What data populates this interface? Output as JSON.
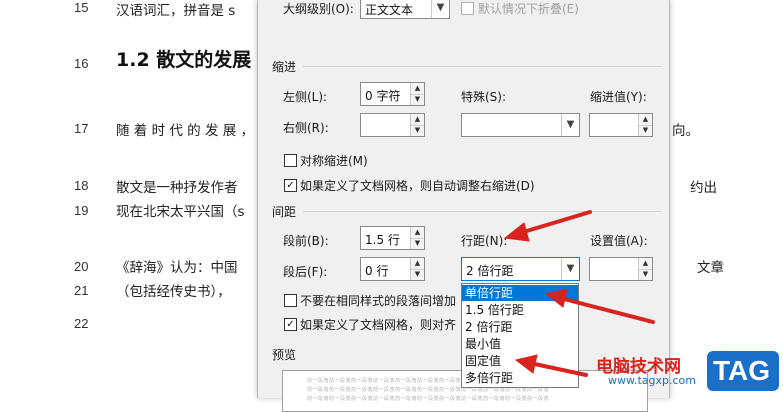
{
  "document": {
    "lines": [
      {
        "num": "15",
        "text": "汉语词汇，拼音是 s"
      },
      {
        "num": "16",
        "heading": "1.2 散文的发展"
      },
      {
        "num": "17",
        "text_left": "随 着 时 代 的 发 展 ，",
        "text_right": "向。"
      },
      {
        "num": "18",
        "text_left": "散文是一种抒发作者",
        "text_right": "约出"
      },
      {
        "num": "19",
        "text_left": "现在北宋太平兴国（s"
      },
      {
        "num": "20",
        "text_left": "《辞海》认为：中国",
        "text_right": "文章"
      },
      {
        "num": "21",
        "text_left": "（包括经传史书），"
      },
      {
        "num": "22"
      }
    ]
  },
  "dialog": {
    "outline_level_label": "大纲级别(O):",
    "outline_level_value": "正文文本",
    "collapsed_default_label": "默认情况下折叠(E)",
    "indent_section": "缩进",
    "left_label": "左侧(L):",
    "left_value": "0 字符",
    "special_label": "特殊(S):",
    "indent_value_label": "缩进值(Y):",
    "right_label": "右侧(R):",
    "mirror_indent_label": "对称缩进(M)",
    "auto_adjust_right_indent_label": "如果定义了文档网格，则自动调整右缩进(D)",
    "spacing_section": "间距",
    "before_label": "段前(B):",
    "before_value": "1.5 行",
    "line_spacing_label": "行距(N):",
    "setting_value_label": "设置值(A):",
    "after_label": "段后(F):",
    "after_value": "0 行",
    "line_spacing_value": "2 倍行距",
    "no_space_same_style_label": "不要在相同样式的段落间增加",
    "snap_to_grid_label": "如果定义了文档网格，则对齐",
    "preview_section": "预览",
    "preview_text": "前一段落前一段落前一段落前一段落前一段落前一段落前一段落前一段落前一段落前一段落前一段落"
  },
  "line_spacing_options": [
    "单倍行距",
    "1.5 倍行距",
    "2 倍行距",
    "最小值",
    "固定值",
    "多倍行距"
  ],
  "selected_option_index": 0,
  "watermark": {
    "brand": "电脑技术网",
    "url": "www.tagxp.com",
    "tag": "TAG"
  },
  "colors": {
    "arrow": "#d9231c",
    "selection": "#0078d7",
    "watermark_red": "#d9231c",
    "tag_blue": "#1a6fc9"
  }
}
